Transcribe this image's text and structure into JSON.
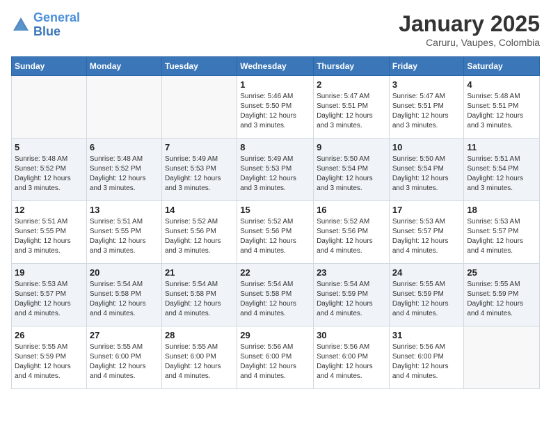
{
  "header": {
    "logo_line1": "General",
    "logo_line2": "Blue",
    "month": "January 2025",
    "location": "Caruru, Vaupes, Colombia"
  },
  "days_of_week": [
    "Sunday",
    "Monday",
    "Tuesday",
    "Wednesday",
    "Thursday",
    "Friday",
    "Saturday"
  ],
  "weeks": [
    [
      {
        "day": "",
        "info": ""
      },
      {
        "day": "",
        "info": ""
      },
      {
        "day": "",
        "info": ""
      },
      {
        "day": "1",
        "info": "Sunrise: 5:46 AM\nSunset: 5:50 PM\nDaylight: 12 hours\nand 3 minutes."
      },
      {
        "day": "2",
        "info": "Sunrise: 5:47 AM\nSunset: 5:51 PM\nDaylight: 12 hours\nand 3 minutes."
      },
      {
        "day": "3",
        "info": "Sunrise: 5:47 AM\nSunset: 5:51 PM\nDaylight: 12 hours\nand 3 minutes."
      },
      {
        "day": "4",
        "info": "Sunrise: 5:48 AM\nSunset: 5:51 PM\nDaylight: 12 hours\nand 3 minutes."
      }
    ],
    [
      {
        "day": "5",
        "info": "Sunrise: 5:48 AM\nSunset: 5:52 PM\nDaylight: 12 hours\nand 3 minutes."
      },
      {
        "day": "6",
        "info": "Sunrise: 5:48 AM\nSunset: 5:52 PM\nDaylight: 12 hours\nand 3 minutes."
      },
      {
        "day": "7",
        "info": "Sunrise: 5:49 AM\nSunset: 5:53 PM\nDaylight: 12 hours\nand 3 minutes."
      },
      {
        "day": "8",
        "info": "Sunrise: 5:49 AM\nSunset: 5:53 PM\nDaylight: 12 hours\nand 3 minutes."
      },
      {
        "day": "9",
        "info": "Sunrise: 5:50 AM\nSunset: 5:54 PM\nDaylight: 12 hours\nand 3 minutes."
      },
      {
        "day": "10",
        "info": "Sunrise: 5:50 AM\nSunset: 5:54 PM\nDaylight: 12 hours\nand 3 minutes."
      },
      {
        "day": "11",
        "info": "Sunrise: 5:51 AM\nSunset: 5:54 PM\nDaylight: 12 hours\nand 3 minutes."
      }
    ],
    [
      {
        "day": "12",
        "info": "Sunrise: 5:51 AM\nSunset: 5:55 PM\nDaylight: 12 hours\nand 3 minutes."
      },
      {
        "day": "13",
        "info": "Sunrise: 5:51 AM\nSunset: 5:55 PM\nDaylight: 12 hours\nand 3 minutes."
      },
      {
        "day": "14",
        "info": "Sunrise: 5:52 AM\nSunset: 5:56 PM\nDaylight: 12 hours\nand 3 minutes."
      },
      {
        "day": "15",
        "info": "Sunrise: 5:52 AM\nSunset: 5:56 PM\nDaylight: 12 hours\nand 4 minutes."
      },
      {
        "day": "16",
        "info": "Sunrise: 5:52 AM\nSunset: 5:56 PM\nDaylight: 12 hours\nand 4 minutes."
      },
      {
        "day": "17",
        "info": "Sunrise: 5:53 AM\nSunset: 5:57 PM\nDaylight: 12 hours\nand 4 minutes."
      },
      {
        "day": "18",
        "info": "Sunrise: 5:53 AM\nSunset: 5:57 PM\nDaylight: 12 hours\nand 4 minutes."
      }
    ],
    [
      {
        "day": "19",
        "info": "Sunrise: 5:53 AM\nSunset: 5:57 PM\nDaylight: 12 hours\nand 4 minutes."
      },
      {
        "day": "20",
        "info": "Sunrise: 5:54 AM\nSunset: 5:58 PM\nDaylight: 12 hours\nand 4 minutes."
      },
      {
        "day": "21",
        "info": "Sunrise: 5:54 AM\nSunset: 5:58 PM\nDaylight: 12 hours\nand 4 minutes."
      },
      {
        "day": "22",
        "info": "Sunrise: 5:54 AM\nSunset: 5:58 PM\nDaylight: 12 hours\nand 4 minutes."
      },
      {
        "day": "23",
        "info": "Sunrise: 5:54 AM\nSunset: 5:59 PM\nDaylight: 12 hours\nand 4 minutes."
      },
      {
        "day": "24",
        "info": "Sunrise: 5:55 AM\nSunset: 5:59 PM\nDaylight: 12 hours\nand 4 minutes."
      },
      {
        "day": "25",
        "info": "Sunrise: 5:55 AM\nSunset: 5:59 PM\nDaylight: 12 hours\nand 4 minutes."
      }
    ],
    [
      {
        "day": "26",
        "info": "Sunrise: 5:55 AM\nSunset: 5:59 PM\nDaylight: 12 hours\nand 4 minutes."
      },
      {
        "day": "27",
        "info": "Sunrise: 5:55 AM\nSunset: 6:00 PM\nDaylight: 12 hours\nand 4 minutes."
      },
      {
        "day": "28",
        "info": "Sunrise: 5:55 AM\nSunset: 6:00 PM\nDaylight: 12 hours\nand 4 minutes."
      },
      {
        "day": "29",
        "info": "Sunrise: 5:56 AM\nSunset: 6:00 PM\nDaylight: 12 hours\nand 4 minutes."
      },
      {
        "day": "30",
        "info": "Sunrise: 5:56 AM\nSunset: 6:00 PM\nDaylight: 12 hours\nand 4 minutes."
      },
      {
        "day": "31",
        "info": "Sunrise: 5:56 AM\nSunset: 6:00 PM\nDaylight: 12 hours\nand 4 minutes."
      },
      {
        "day": "",
        "info": ""
      }
    ]
  ]
}
